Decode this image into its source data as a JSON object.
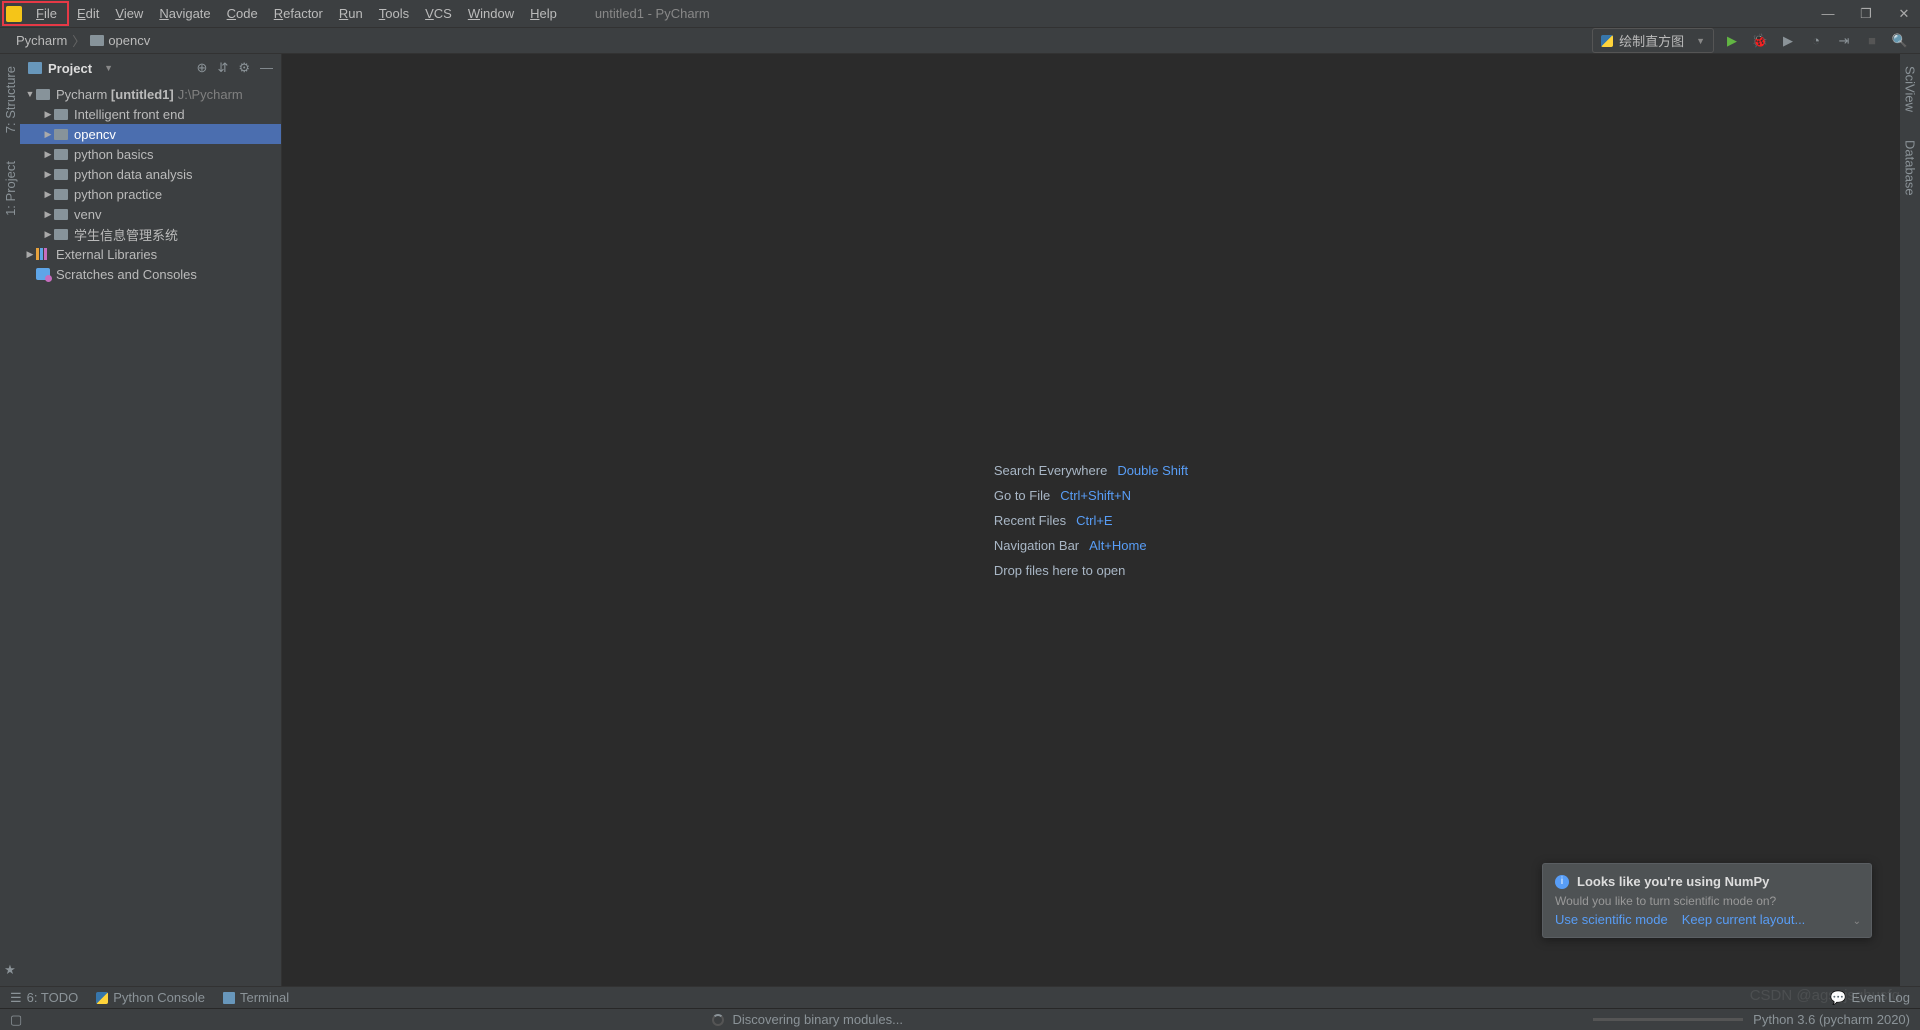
{
  "window": {
    "title": "untitled1 - PyCharm"
  },
  "menu": [
    "File",
    "Edit",
    "View",
    "Navigate",
    "Code",
    "Refactor",
    "Run",
    "Tools",
    "VCS",
    "Window",
    "Help"
  ],
  "breadcrumb": {
    "root": "Pycharm",
    "folder": "opencv"
  },
  "runConfig": {
    "label": "绘制直方图"
  },
  "leftStrip": [
    "7: Structure",
    "1: Project"
  ],
  "rightStrip": [
    "SciView",
    "Database"
  ],
  "projectPanel": {
    "title": "Project"
  },
  "tree": {
    "root": {
      "name": "Pycharm",
      "project": "[untitled1]",
      "path": "J:\\Pycharm"
    },
    "folders": [
      "Intelligent front end",
      "opencv",
      "python basics",
      "python data analysis",
      "python practice",
      "venv",
      "学生信息管理系统"
    ],
    "external": "External Libraries",
    "scratch": "Scratches and Consoles"
  },
  "hints": [
    {
      "label": "Search Everywhere",
      "key": "Double Shift"
    },
    {
      "label": "Go to File",
      "key": "Ctrl+Shift+N"
    },
    {
      "label": "Recent Files",
      "key": "Ctrl+E"
    },
    {
      "label": "Navigation Bar",
      "key": "Alt+Home"
    },
    {
      "label": "Drop files here to open",
      "key": ""
    }
  ],
  "notification": {
    "title": "Looks like you're using NumPy",
    "body": "Would you like to turn scientific mode on?",
    "link1": "Use scientific mode",
    "link2": "Keep current layout..."
  },
  "bottomTools": {
    "todo": "6: TODO",
    "console": "Python Console",
    "terminal": "Terminal",
    "eventLog": "Event Log"
  },
  "status": {
    "task": "Discovering binary modules...",
    "interpreter": "Python 3.6 (pycharm    2020)"
  },
  "watermark": "CSDN @agsgjsghusfg"
}
